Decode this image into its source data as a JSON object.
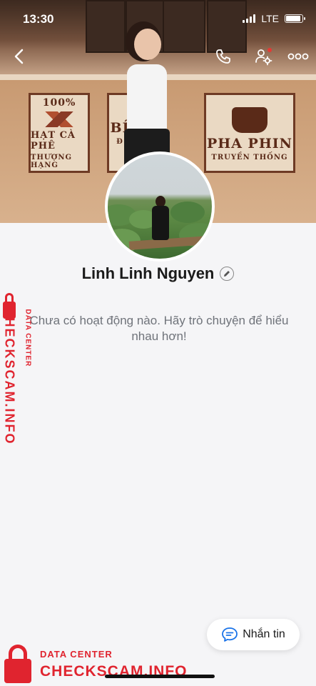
{
  "status_bar": {
    "time": "13:30",
    "network": "LTE"
  },
  "cover": {
    "panel_left_line1": "100%",
    "panel_left_line2": "HẠT CÀ PHÊ",
    "panel_left_line3": "THƯỢNG HẠNG",
    "panel_mid_line1": "BÍ",
    "panel_mid_line2": "Đ",
    "panel_right_line1": "PHA PHIN",
    "panel_right_line2": "TRUYỀN THỐNG"
  },
  "profile": {
    "name": "Linh Linh Nguyen"
  },
  "empty_state": {
    "message": "Chưa có hoạt động nào. Hãy trò chuyện để hiểu nhau hơn!"
  },
  "chat_button": {
    "label": "Nhắn tin"
  },
  "watermark": {
    "side_main": "CHECKSCAM.INFO",
    "side_sub": "DATA CENTER",
    "bottom_sub": "DATA CENTER",
    "bottom_main": "CHECKSCAM.INFO"
  },
  "colors": {
    "watermark_red": "#e0242f",
    "chat_icon_blue": "#1a73e8"
  }
}
